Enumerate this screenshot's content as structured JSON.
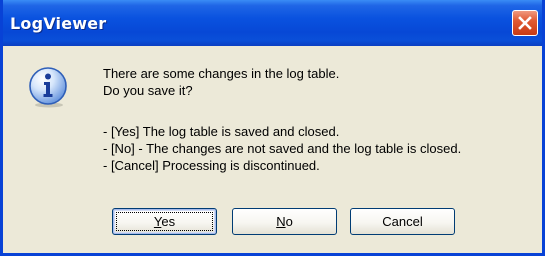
{
  "window": {
    "title": "LogViewer"
  },
  "dialog": {
    "icon": "info-icon",
    "message_lines": [
      "There are some changes in the log table.",
      "Do you save it?",
      "- [Yes] The log table is saved and closed.",
      "- [No] - The changes are not saved and the log table is closed.",
      "- [Cancel] Processing is discontinued."
    ]
  },
  "buttons": {
    "yes": {
      "mnemonic": "Y",
      "rest": "es"
    },
    "no": {
      "mnemonic": "N",
      "rest": "o"
    },
    "cancel": {
      "label": "Cancel"
    }
  },
  "colors": {
    "titlebar": "#0a52df",
    "frame": "#0842d6",
    "face": "#ece9d8",
    "close": "#e05a33"
  }
}
